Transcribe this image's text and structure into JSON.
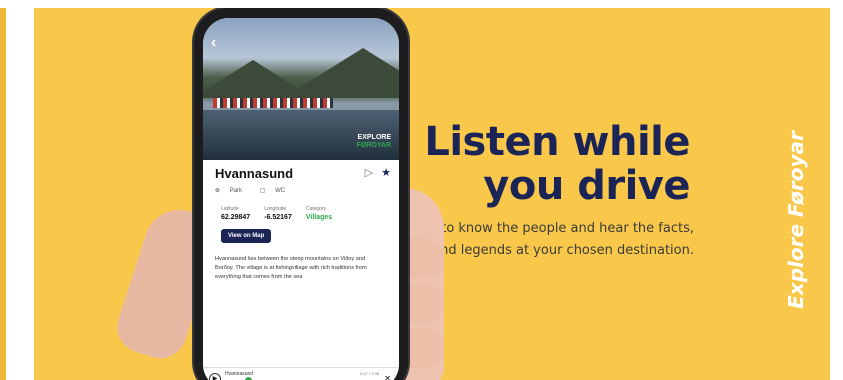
{
  "headline": {
    "line1": "Listen while",
    "line2": "you drive"
  },
  "subtext": {
    "line1": "Get to know the people and hear the facts,",
    "line2": "stories and legends at your chosen destination."
  },
  "brand": "Explore Føroyar",
  "phone": {
    "back": "‹",
    "logo": {
      "line1": "EXPLORE",
      "line2": "FØROYAR"
    },
    "place": {
      "title": "Hvannasund",
      "amenities": [
        "Park",
        "WC"
      ],
      "stats": [
        {
          "label": "Latitude",
          "value": "62.29847"
        },
        {
          "label": "Longitude",
          "value": "-6.52167"
        },
        {
          "label": "Category",
          "value": "Villages"
        }
      ],
      "view_map": "View on Map",
      "description": [
        "Hvannasund lies between the steep mountains on Viðoy and",
        "Borðoy. The village is at fishingvillage with rich traditions from",
        "everything that comes from the sea"
      ]
    },
    "player": {
      "track": "Hvannasund",
      "time": "0:17 / 2:38"
    }
  },
  "colors": {
    "banner": "#f9c84a",
    "navy": "#1b2456",
    "green": "#2fa84f"
  },
  "icons": [
    "back-arrow-icon",
    "play-icon",
    "star-icon",
    "park-icon",
    "wc-icon",
    "close-icon"
  ]
}
